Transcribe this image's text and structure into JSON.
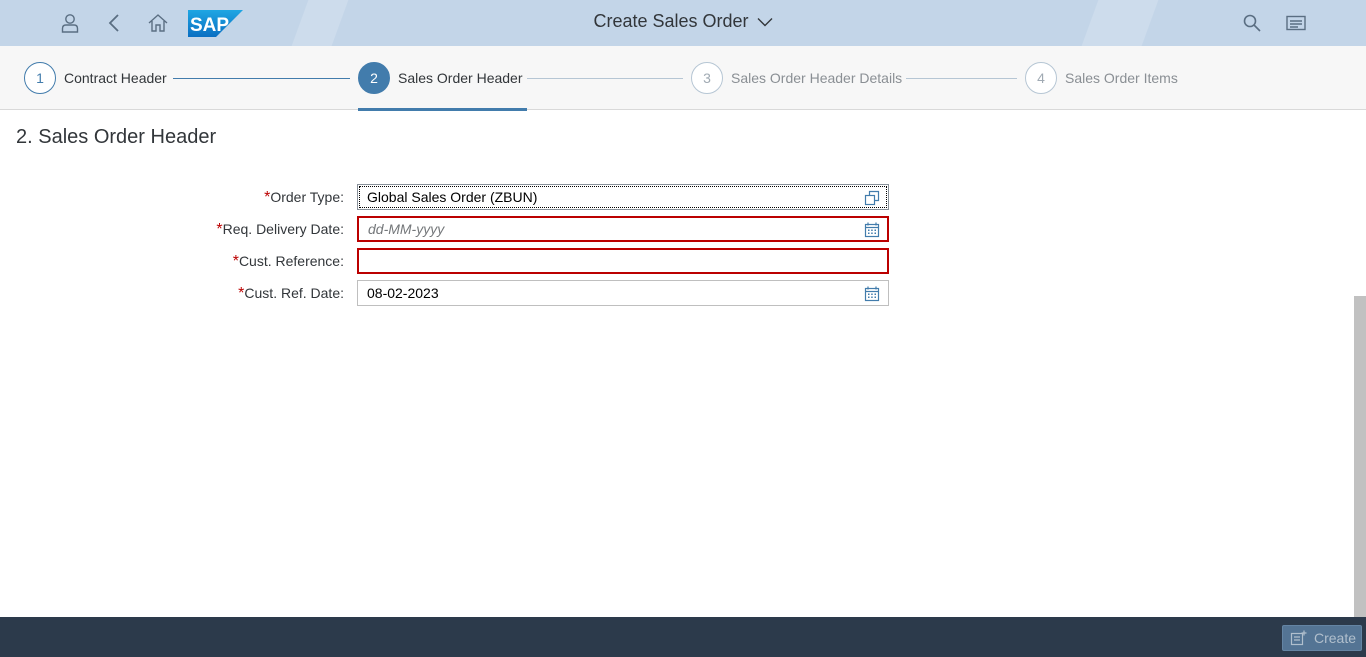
{
  "shell": {
    "title": "Create Sales Order",
    "logo_text": "SAP",
    "icons": [
      "user-icon",
      "back-icon",
      "home-icon",
      "search-icon",
      "menu-icon"
    ],
    "bar_color": "#c3d5e8"
  },
  "wizard": {
    "steps": [
      {
        "number": "1",
        "label": "Contract Header",
        "state": "completed"
      },
      {
        "number": "2",
        "label": "Sales Order Header",
        "state": "active"
      },
      {
        "number": "3",
        "label": "Sales Order Header Details",
        "state": "disabled"
      },
      {
        "number": "4",
        "label": "Sales Order Items",
        "state": "disabled"
      }
    ],
    "accent": "#427cac"
  },
  "form": {
    "section_title": "2. Sales Order Header",
    "required_marker": "*",
    "fields": [
      {
        "label": "Order Type:",
        "value": "Global Sales Order (ZBUN)",
        "placeholder": "",
        "icon": "value-help-icon",
        "state": "focused"
      },
      {
        "label": "Req. Delivery Date:",
        "value": "",
        "placeholder": "dd-MM-yyyy",
        "icon": "calendar-icon",
        "state": "error"
      },
      {
        "label": "Cust. Reference:",
        "value": "",
        "placeholder": "",
        "icon": "",
        "state": "error"
      },
      {
        "label": "Cust. Ref. Date:",
        "value": "08-02-2023",
        "placeholder": "",
        "icon": "calendar-icon",
        "state": "normal"
      }
    ],
    "error_color": "#bb0000"
  },
  "footer": {
    "create_label": "Create",
    "create_icon": "create-doc-icon",
    "bar_color": "#2c3a4b"
  }
}
